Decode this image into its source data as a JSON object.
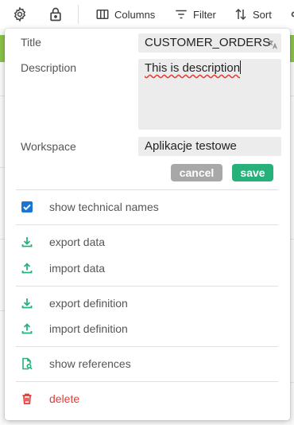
{
  "toolbar": {
    "columns_label": "Columns",
    "filter_label": "Filter",
    "sort_label": "Sort"
  },
  "form": {
    "title_label": "Title",
    "title_value": "CUSTOMER_ORDERS",
    "description_label": "Description",
    "description_value": "This is description",
    "workspace_label": "Workspace",
    "workspace_value": "Aplikacje testowe",
    "cancel_label": "cancel",
    "save_label": "save"
  },
  "menu": {
    "show_technical_names": "show technical names",
    "show_technical_names_checked": true,
    "export_data": "export data",
    "import_data": "import data",
    "export_definition": "export definition",
    "import_definition": "import definition",
    "show_references": "show references",
    "delete": "delete"
  },
  "colors": {
    "accent_green": "#26b17b",
    "cancel_gray": "#a8a8a8",
    "danger_red": "#e53935",
    "checkbox_blue": "#1976d2"
  }
}
